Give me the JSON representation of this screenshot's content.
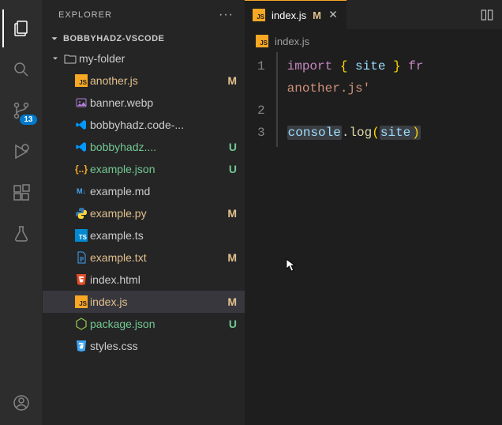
{
  "activity": {
    "source_control_badge": "13"
  },
  "sidebar": {
    "title": "EXPLORER",
    "project": "BOBBYHADZ-VSCODE",
    "folder": "my-folder",
    "files": [
      {
        "label": "another.js",
        "icon": "js",
        "status": "M"
      },
      {
        "label": "banner.webp",
        "icon": "img",
        "status": ""
      },
      {
        "label": "bobbyhadz.code-...",
        "icon": "vscode",
        "status": ""
      },
      {
        "label": "bobbyhadz....",
        "icon": "vscode",
        "status": "U"
      },
      {
        "label": "example.json",
        "icon": "json",
        "status": "U"
      },
      {
        "label": "example.md",
        "icon": "md",
        "status": ""
      },
      {
        "label": "example.py",
        "icon": "py",
        "status": "M"
      },
      {
        "label": "example.ts",
        "icon": "ts",
        "status": ""
      },
      {
        "label": "example.txt",
        "icon": "txt",
        "status": "M"
      },
      {
        "label": "index.html",
        "icon": "html",
        "status": ""
      },
      {
        "label": "index.js",
        "icon": "js",
        "status": "M"
      },
      {
        "label": "package.json",
        "icon": "node",
        "status": "U"
      },
      {
        "label": "styles.css",
        "icon": "css",
        "status": ""
      }
    ],
    "selected_index": 10
  },
  "tabs": {
    "open": {
      "label": "index.js",
      "status": "M"
    }
  },
  "breadcrumb": {
    "file": "index.js"
  },
  "editor": {
    "lines": [
      "1",
      "2",
      "3"
    ],
    "line1": {
      "import": "import",
      "lbrace": "{",
      "ident": "site",
      "rbrace": "}",
      "from_fragment": "fr"
    },
    "line1b": {
      "string": "another.js'"
    },
    "line3": {
      "obj": "console",
      "dot": ".",
      "fn": "log",
      "lparen": "(",
      "arg": "site",
      "rparen": ")"
    }
  }
}
